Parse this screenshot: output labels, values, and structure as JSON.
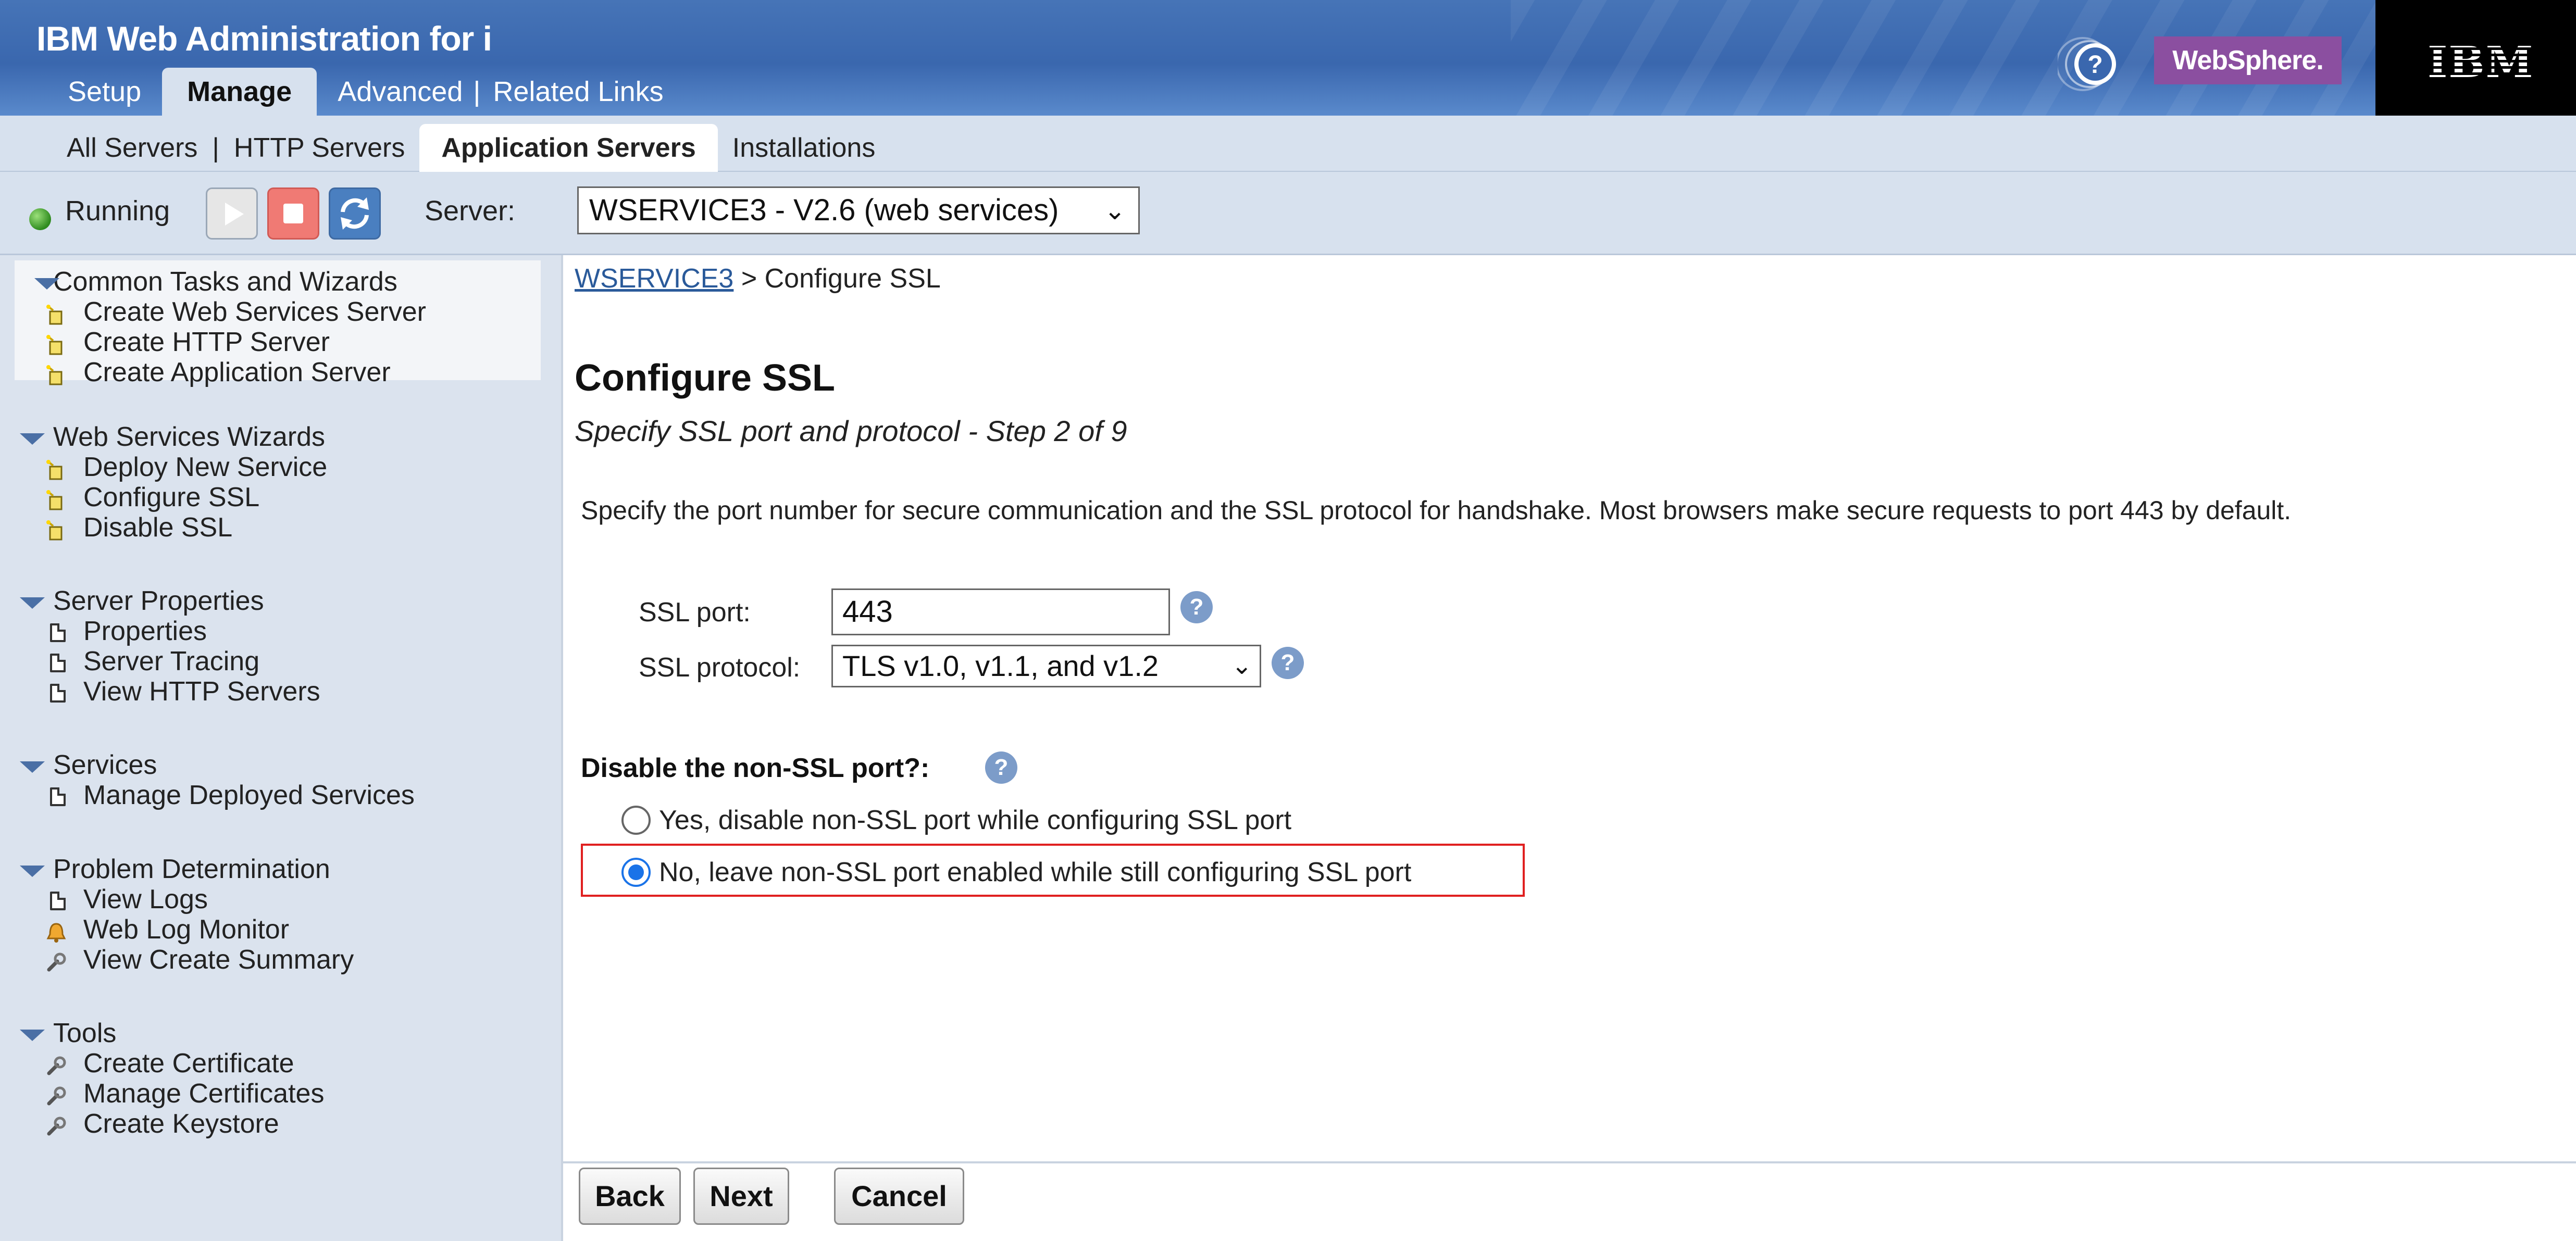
{
  "header": {
    "app_title": "IBM Web Administration for i",
    "tabs": [
      {
        "label": "Setup"
      },
      {
        "label": "Manage"
      },
      {
        "label": "Advanced"
      },
      {
        "label": "Related Links"
      }
    ],
    "brand_badge": "WebSphere.",
    "ibm_logo": "IBM",
    "help_icon": "question-circle-icon"
  },
  "subnav": {
    "tabs": [
      {
        "label": "All Servers"
      },
      {
        "label": "HTTP Servers"
      },
      {
        "label": "Application Servers"
      },
      {
        "label": "Installations"
      }
    ]
  },
  "toolbar": {
    "status": "Running",
    "server_label": "Server:",
    "server_value": "WSERVICE3 - V2.6 (web services)",
    "icons": [
      "start-icon",
      "stop-icon",
      "refresh-icon"
    ]
  },
  "sidebar": {
    "sections": [
      {
        "title": "Common Tasks and Wizards",
        "items": [
          {
            "label": "Create Web Services Server",
            "icon": "wizard-icon"
          },
          {
            "label": "Create HTTP Server",
            "icon": "wizard-icon"
          },
          {
            "label": "Create Application Server",
            "icon": "wizard-icon"
          }
        ]
      },
      {
        "title": "Web Services Wizards",
        "items": [
          {
            "label": "Deploy New Service",
            "icon": "wizard-icon"
          },
          {
            "label": "Configure SSL",
            "icon": "wizard-icon"
          },
          {
            "label": "Disable SSL",
            "icon": "wizard-icon"
          }
        ]
      },
      {
        "title": "Server Properties",
        "items": [
          {
            "label": "Properties",
            "icon": "page-icon"
          },
          {
            "label": "Server Tracing",
            "icon": "page-icon"
          },
          {
            "label": "View HTTP Servers",
            "icon": "page-icon"
          }
        ]
      },
      {
        "title": "Services",
        "items": [
          {
            "label": "Manage Deployed Services",
            "icon": "page-icon"
          }
        ]
      },
      {
        "title": "Problem Determination",
        "items": [
          {
            "label": "View Logs",
            "icon": "page-icon"
          },
          {
            "label": "Web Log Monitor",
            "icon": "bell-icon"
          },
          {
            "label": "View Create Summary",
            "icon": "wrench-icon"
          }
        ]
      },
      {
        "title": "Tools",
        "items": [
          {
            "label": "Create Certificate",
            "icon": "wrench-icon"
          },
          {
            "label": "Manage Certificates",
            "icon": "wrench-icon"
          },
          {
            "label": "Create Keystore",
            "icon": "wrench-icon"
          }
        ]
      }
    ]
  },
  "main": {
    "breadcrumb_link": "WSERVICE3",
    "breadcrumb_rest": "> Configure SSL",
    "title": "Configure SSL",
    "subtitle": "Specify SSL port and protocol - Step 2 of 9",
    "description": "Specify the port number for secure communication and the SSL protocol for handshake. Most browsers make secure requests to port 443 by default.",
    "ssl_port_label": "SSL port:",
    "ssl_port_value": "443",
    "ssl_protocol_label": "SSL protocol:",
    "ssl_protocol_value": "TLS v1.0, v1.1, and v1.2",
    "disable_question": "Disable the non-SSL port?:",
    "radio_yes": "Yes, disable non-SSL port while configuring SSL port",
    "radio_no": "No, leave non-SSL port enabled while still configuring SSL port",
    "selected_radio": "no",
    "buttons": {
      "back": "Back",
      "next": "Next",
      "cancel": "Cancel"
    }
  },
  "colors": {
    "header_blue": "#3a67ae",
    "nav_light": "#d7e1ee",
    "websphere_purple": "#8b4fa0",
    "highlight_red": "#e02020",
    "link_blue": "#2a5a9a"
  }
}
